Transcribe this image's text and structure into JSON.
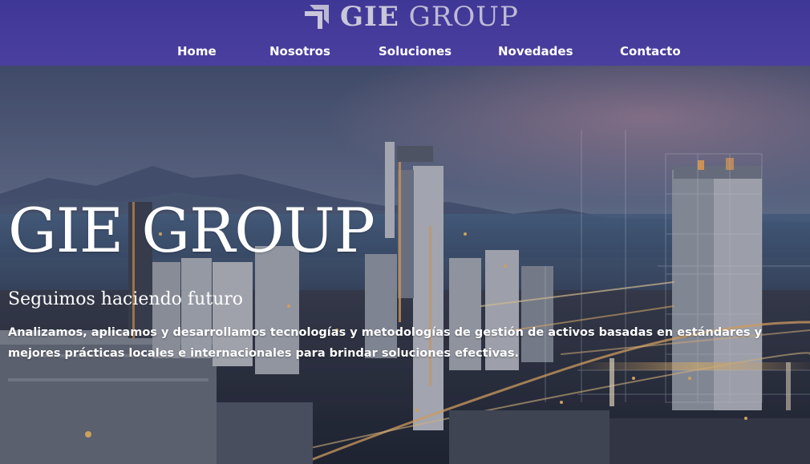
{
  "brand": {
    "name_bold": "GIE",
    "name_light": "GROUP",
    "logo_icon": "arrow-corner-logo-icon"
  },
  "nav": {
    "items": [
      {
        "label": "Home"
      },
      {
        "label": "Nosotros"
      },
      {
        "label": "Soluciones"
      },
      {
        "label": "Novedades"
      },
      {
        "label": "Contacto"
      }
    ]
  },
  "hero": {
    "title": "GIE GROUP",
    "subtitle": "Seguimos haciendo futuro",
    "description": "Analizamos, aplicamos y desarrollamos tecnologías y metodologías de gestión de activos basadas en estándares y mejores prácticas locales e internacionales para brindar soluciones efectivas.",
    "background": "industrial-plant-night-photo"
  },
  "colors": {
    "header_bg": "#3f3796",
    "nav_text": "#ffffff",
    "hero_text": "#ffffff"
  }
}
